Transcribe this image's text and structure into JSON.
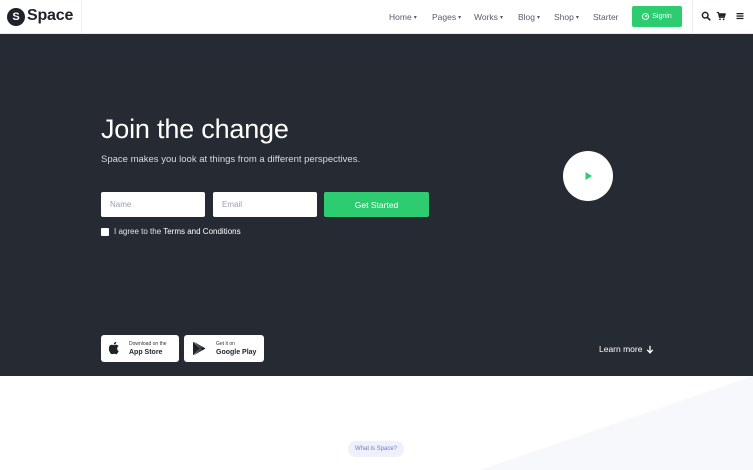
{
  "header": {
    "logo_letter": "S",
    "logo_text": "Space",
    "nav": [
      {
        "label": "Home",
        "dropdown": true
      },
      {
        "label": "Pages",
        "dropdown": true
      },
      {
        "label": "Works",
        "dropdown": true
      },
      {
        "label": "Blog",
        "dropdown": true
      },
      {
        "label": "Shop",
        "dropdown": true
      },
      {
        "label": "Starter",
        "dropdown": false
      }
    ],
    "caret": "▾",
    "signin_label": "Signin",
    "icons": [
      "search-icon",
      "cart-icon",
      "menu-icon"
    ]
  },
  "hero": {
    "title": "Join the change",
    "subtitle": "Space makes you look at things from a different perspectives.",
    "name_placeholder": "Name",
    "email_placeholder": "Email",
    "cta_label": "Get Started",
    "agree_prefix": "I agree to the ",
    "agree_link": "Terms and Conditions",
    "app_store": {
      "small": "Download on the",
      "big": "App Store"
    },
    "google_play": {
      "small": "Get it on",
      "big": "Google Play"
    },
    "learn_more": "Learn more"
  },
  "section": {
    "badge": "What is Space?"
  },
  "colors": {
    "accent": "#2ecc71",
    "hero_bg": "#262a33",
    "badge_text": "#6c7ae0"
  }
}
